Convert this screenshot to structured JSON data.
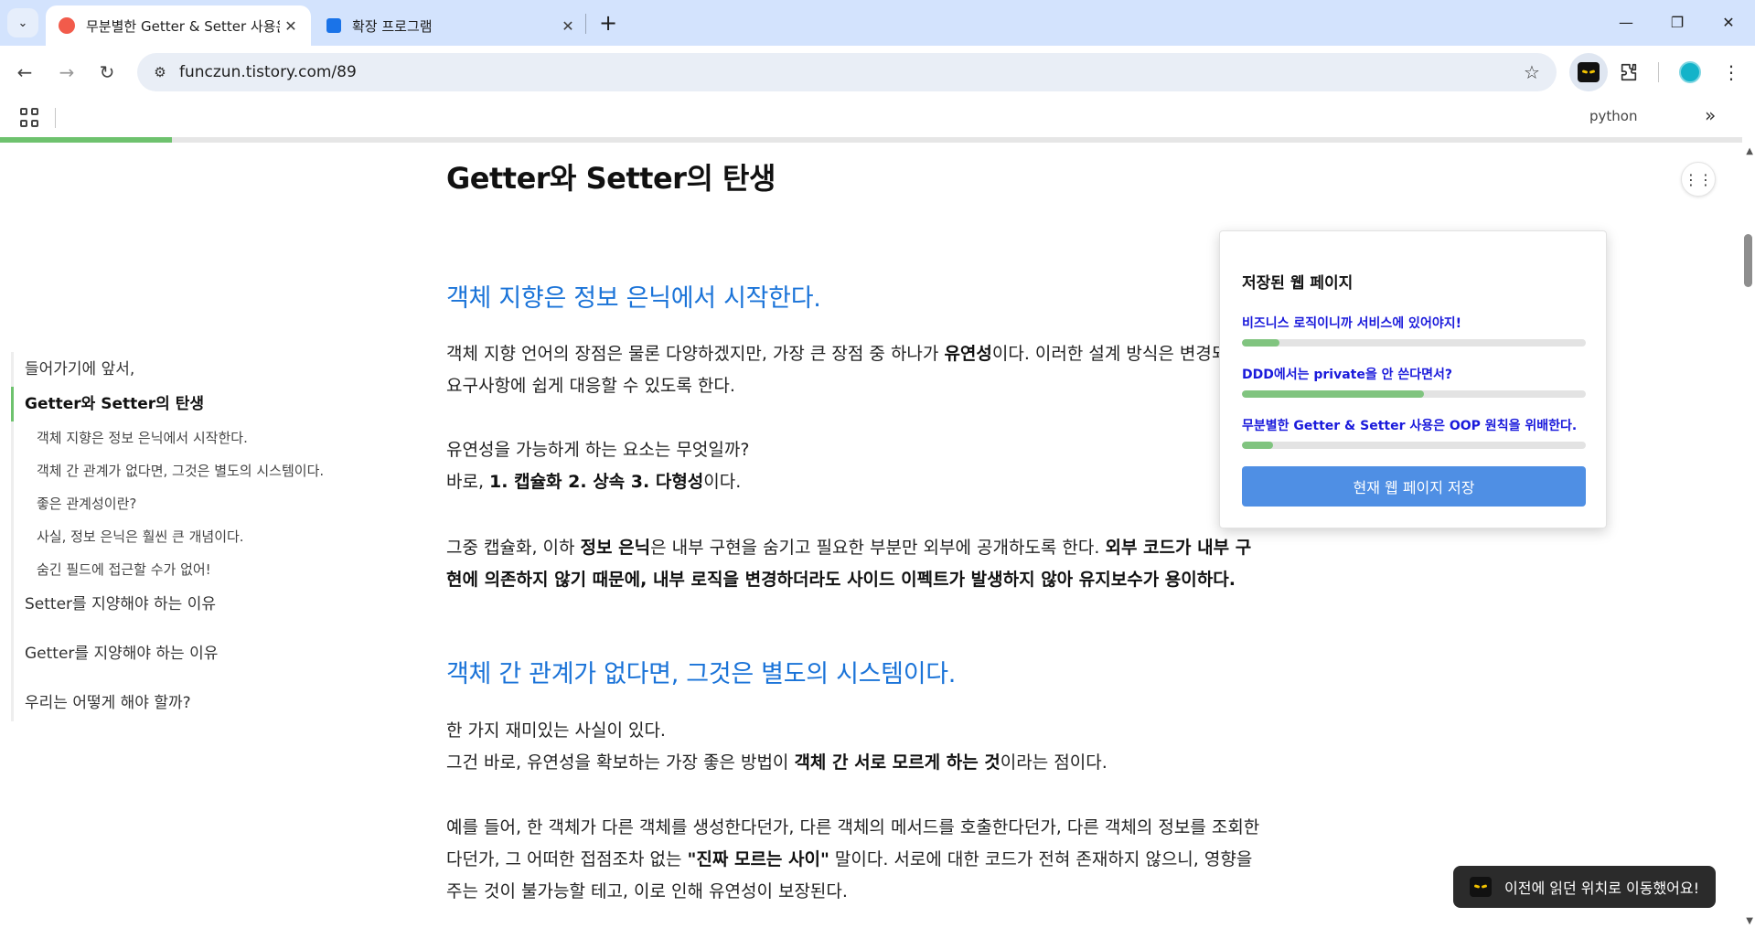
{
  "browser": {
    "tabs": [
      {
        "title": "무분별한 Getter & Setter 사용은",
        "favicon_color": "#f25b4b",
        "active": true
      },
      {
        "title": "확장 프로그램",
        "favicon_color": "#1a73e8",
        "active": false
      }
    ],
    "url": "funczun.tistory.com/89",
    "bookmarks": {
      "python_label": "python"
    },
    "icons": {
      "tab_search": "chevron-down",
      "close": "close",
      "new_tab": "plus",
      "back": "arrow-left",
      "forward": "arrow-right",
      "reload": "reload",
      "site_info": "tune",
      "bookmark": "star",
      "extensions": "puzzle",
      "menu": "vertical-dots",
      "apps": "apps-grid",
      "more_bookmarks": "double-chevron-right"
    }
  },
  "reading_progress": 0.0987,
  "toc": {
    "items": [
      {
        "label": "들어가기에 앞서,",
        "level": 1,
        "active": false
      },
      {
        "label": "Getter와 Setter의 탄생",
        "level": 1,
        "active": true
      },
      {
        "label": "객체 지향은 정보 은닉에서 시작한다.",
        "level": 2,
        "active": false
      },
      {
        "label": "객체 간 관계가 없다면, 그것은 별도의 시스템이다.",
        "level": 2,
        "active": false
      },
      {
        "label": "좋은 관계성이란?",
        "level": 2,
        "active": false
      },
      {
        "label": "사실, 정보 은닉은 훨씬 큰 개념이다.",
        "level": 2,
        "active": false
      },
      {
        "label": "숨긴 필드에 접근할 수가 없어!",
        "level": 2,
        "active": false
      },
      {
        "label": "Setter를 지양해야 하는 이유",
        "level": 1,
        "active": false
      },
      {
        "label": "Getter를 지양해야 하는 이유",
        "level": 1,
        "active": false
      },
      {
        "label": "우리는 어떻게 해야 할까?",
        "level": 1,
        "active": false
      }
    ]
  },
  "article": {
    "h2": "Getter와 Setter의 탄생",
    "section1": {
      "heading": "객체 지향은 정보 은닉에서 시작한다.",
      "p1a": "객체 지향 언어의 장점은 물론 다양하겠지만, 가장 큰 장점 중 하나가 ",
      "p1b": "유연성",
      "p1c": "이다. 이러한 설계 방식은 변경되는",
      "p1d": "요구사항에 쉽게 대응할 수 있도록 한다.",
      "p2a": "유연성을 가능하게 하는 요소는 무엇일까?",
      "p2b": "바로, ",
      "p2c": "1. 캡슐화 2. 상속 3. 다형성",
      "p2d": "이다.",
      "p3a": "그중 캡슐화, 이하 ",
      "p3b": "정보 은닉",
      "p3c": "은 내부 구현을 숨기고 필요한 부분만 외부에 공개하도록 한다. ",
      "p3d": "외부 코드가 내부 구",
      "p3e": "현에 의존하지 않기 때문에, 내부 로직을 변경하더라도 사이드 이펙트가 발생하지 않아 유지보수가 용이하다."
    },
    "section2": {
      "heading": "객체 간 관계가 없다면, 그것은 별도의 시스템이다.",
      "p1": "한 가지 재미있는 사실이 있다.",
      "p2a": "그건 바로, 유연성을 확보하는 가장 좋은 방법이 ",
      "p2b": "객체 간 서로 모르게 하는 것",
      "p2c": "이라는 점이다.",
      "p3a": "예를 들어, 한 객체가 다른 객체를 생성한다던가, 다른 객체의 메서드를 호출한다던가, 다른 객체의 정보를 조회한",
      "p3b": "다던가, 그 어떠한 접점조차 없는 ",
      "p3c": "\"진짜 모르는 사이\"",
      "p3d": " 말이다. 서로에 대한 코드가 전혀 존재하지 않으니, 영향을",
      "p3e": "주는 것이 불가능할 테고, 이로 인해 유연성이 보장된다."
    }
  },
  "popup": {
    "title": "저장된 웹 페이지",
    "items": [
      {
        "title": "비즈니스 로직이니까 서비스에 있어야지!",
        "progress": 0.11
      },
      {
        "title": "DDD에서는 private을 안 쓴다면서?",
        "progress": 0.53
      },
      {
        "title": "무분별한 Getter & Setter 사용은 OOP 원칙을 위배한다.",
        "progress": 0.09
      }
    ],
    "save_button": "현재 웹 페이지 저장"
  },
  "toast": {
    "message": "이전에 읽던 위치로 이동했어요!"
  },
  "colors": {
    "tabstrip": "#d3e3fd",
    "heading_blue": "#1a73d8",
    "progress_green": "#6ec26e",
    "popup_link": "#1a1adb",
    "save_button": "#4f8fe4",
    "toast_bg": "#2b2b2b"
  }
}
